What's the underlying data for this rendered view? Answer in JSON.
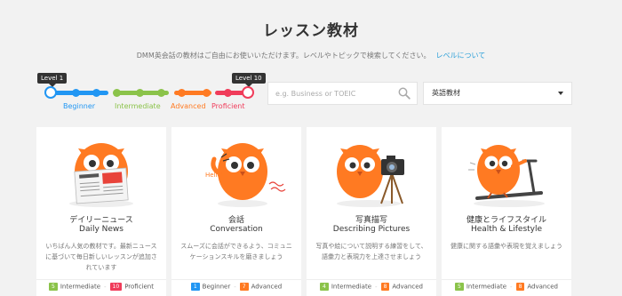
{
  "header": {
    "title": "レッスン教材",
    "subtitle": "DMM英会話の教材はご自由にお使いいただけます。レベルやトピックで検索してください。",
    "level_link": "レベルについて"
  },
  "level_slider": {
    "min_badge": "Level 1",
    "max_badge": "Level 10",
    "levels": [
      {
        "label": "Beginner",
        "color": "#2196f3"
      },
      {
        "label": "Intermediate",
        "color": "#8bc34a"
      },
      {
        "label": "Advanced",
        "color": "#ff7a22"
      },
      {
        "label": "Proficient",
        "color": "#f03c5a"
      }
    ]
  },
  "search": {
    "placeholder": "e.g. Business or TOEIC",
    "value": "",
    "icon": "search-icon"
  },
  "category_select": {
    "selected": "英語教材",
    "icon": "chevron-down-icon"
  },
  "cards": [
    {
      "title_ja": "デイリーニュース",
      "title_en": "Daily News",
      "description": "いちばん人気の教材です。最新ニュースに基づいて毎日新しいレッスンが追加されています",
      "illustration": "owl-reading-newspaper",
      "range_from": {
        "num": "5",
        "label": "Intermediate",
        "color": "#8bc34a"
      },
      "range_to": {
        "num": "10",
        "label": "Proficient",
        "color": "#f03c5a"
      }
    },
    {
      "title_ja": "会話",
      "title_en": "Conversation",
      "description": "スムーズに会話ができるよう、コミュニケーションスキルを磨きましょう",
      "illustration": "owl-saying-hello",
      "hello_text": "Hello!",
      "range_from": {
        "num": "1",
        "label": "Beginner",
        "color": "#2196f3"
      },
      "range_to": {
        "num": "7",
        "label": "Advanced",
        "color": "#ff7a22"
      }
    },
    {
      "title_ja": "写真描写",
      "title_en": "Describing Pictures",
      "description": "写真や絵について説明する練習をして、語彙力と表現力を上達させましょう",
      "illustration": "owl-with-camera",
      "range_from": {
        "num": "4",
        "label": "Intermediate",
        "color": "#8bc34a"
      },
      "range_to": {
        "num": "8",
        "label": "Advanced",
        "color": "#ff7a22"
      }
    },
    {
      "title_ja": "健康とライフスタイル",
      "title_en": "Health & Lifestyle",
      "description": "健康に関する語彙や表現を覚えましょう",
      "illustration": "owl-on-treadmill",
      "range_from": {
        "num": "5",
        "label": "Intermediate",
        "color": "#8bc34a"
      },
      "range_to": {
        "num": "8",
        "label": "Advanced",
        "color": "#ff7a22"
      }
    }
  ]
}
